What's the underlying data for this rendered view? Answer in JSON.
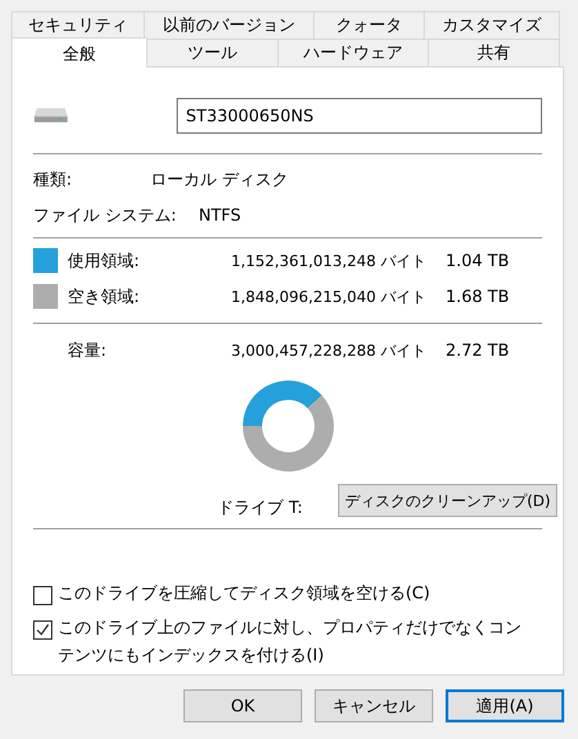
{
  "tab_rows": [
    [
      {
        "label": "セキュリティ",
        "selected": false
      },
      {
        "label": "以前のバージョン",
        "selected": false
      },
      {
        "label": "クォータ",
        "selected": false
      },
      {
        "label": "カスタマイズ",
        "selected": false
      }
    ],
    [
      {
        "label": "全般",
        "selected": true
      },
      {
        "label": "ツール",
        "selected": false
      },
      {
        "label": "ハードウェア",
        "selected": false
      },
      {
        "label": "共有",
        "selected": false
      }
    ]
  ],
  "drive_name": {
    "value": "ST33000650NS"
  },
  "info": [
    {
      "label": "種類:",
      "value": "ローカル ディスク"
    },
    {
      "label": "ファイル システム:",
      "value": "NTFS"
    }
  ],
  "usage": [
    {
      "label": "使用領域:",
      "bytes": "1,152,361,013,248 バイト",
      "size": "1.04 TB",
      "color": "#26a0da"
    },
    {
      "label": "空き領域:",
      "bytes": "1,848,096,215,040 バイト",
      "size": "1.68 TB",
      "color": "#adadad"
    }
  ],
  "capacity": {
    "label": "容量:",
    "bytes": "3,000,457,228,288 バイト",
    "size": "2.72 TB"
  },
  "chart_data": {
    "type": "donut",
    "values": [
      38.2,
      61.8
    ]
  },
  "drive_label": "ドライブ T:",
  "cleanup_button": "ディスクのクリーンアップ(D)",
  "options": [
    {
      "label": "このドライブを圧縮してディスク領域を空ける(C)",
      "checked": false
    },
    {
      "label": "このドライブ上のファイルに対し、プロパティだけでなくコンテンツにもインデックスを付ける(I)",
      "checked": true
    }
  ],
  "buttons": [
    {
      "label": "OK",
      "focused": false
    },
    {
      "label": "キャンセル",
      "focused": false
    },
    {
      "label": "適用(A)",
      "focused": true
    }
  ]
}
